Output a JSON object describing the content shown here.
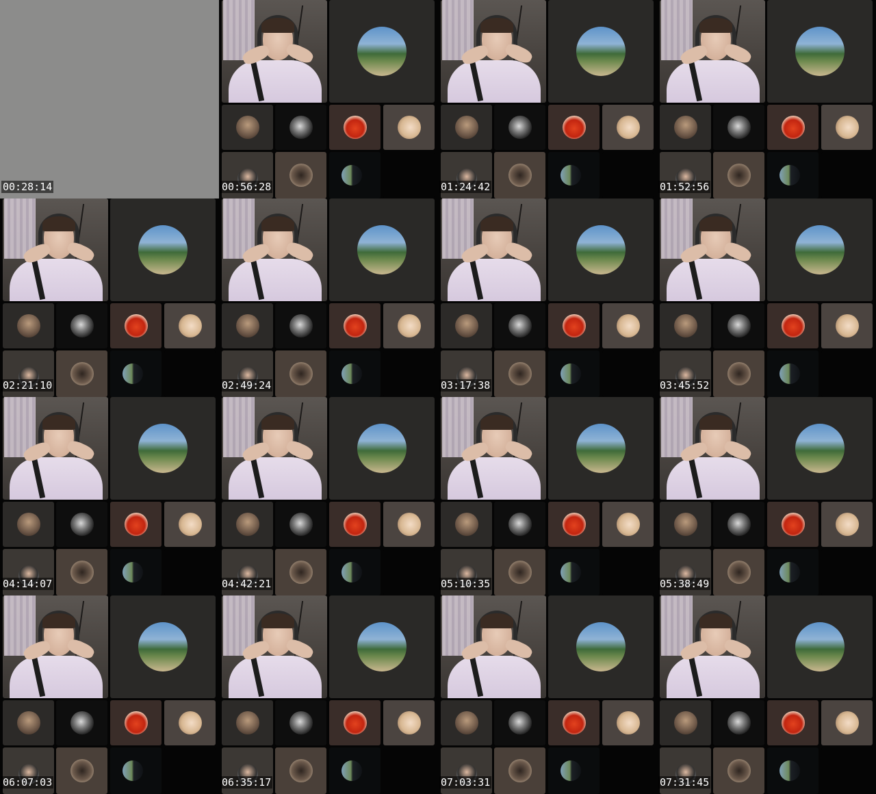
{
  "sheet": {
    "background_color": "#000000",
    "blank_frame_color": "#8c8c8b",
    "frames": [
      {
        "timestamp": "00:28:14",
        "content": "blank"
      },
      {
        "timestamp": "00:56:28",
        "content": "call"
      },
      {
        "timestamp": "01:24:42",
        "content": "call"
      },
      {
        "timestamp": "01:52:56",
        "content": "call"
      },
      {
        "timestamp": "02:21:10",
        "content": "call"
      },
      {
        "timestamp": "02:49:24",
        "content": "call"
      },
      {
        "timestamp": "03:17:38",
        "content": "call"
      },
      {
        "timestamp": "03:45:52",
        "content": "call"
      },
      {
        "timestamp": "04:14:07",
        "content": "call"
      },
      {
        "timestamp": "04:42:21",
        "content": "call"
      },
      {
        "timestamp": "05:10:35",
        "content": "call"
      },
      {
        "timestamp": "05:38:49",
        "content": "call"
      },
      {
        "timestamp": "06:07:03",
        "content": "call"
      },
      {
        "timestamp": "06:35:17",
        "content": "call"
      },
      {
        "timestamp": "07:03:31",
        "content": "call"
      },
      {
        "timestamp": "07:31:45",
        "content": "call"
      }
    ]
  }
}
